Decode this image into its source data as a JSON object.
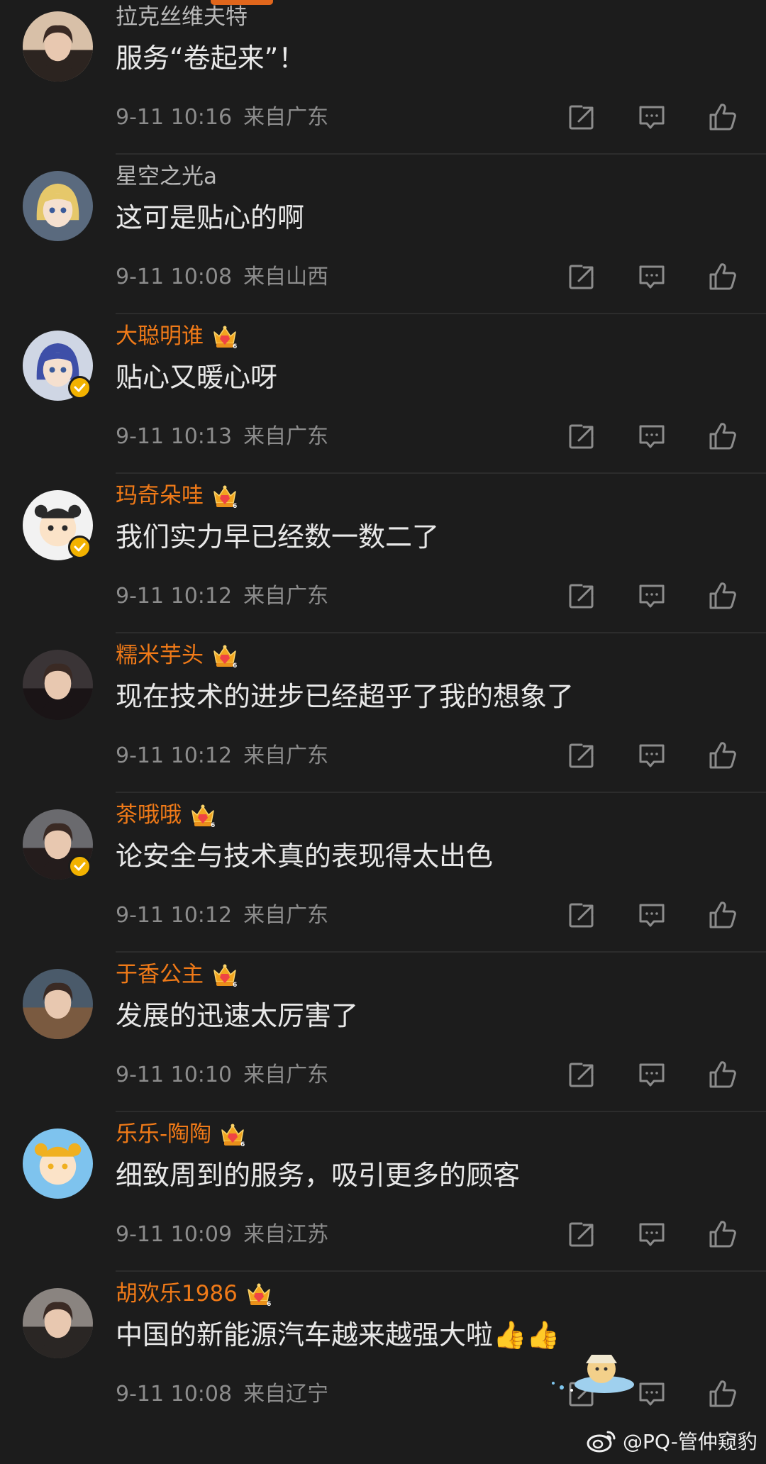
{
  "colors": {
    "background": "#1c1c1c",
    "text": "#e8e8e8",
    "meta": "#8c8c8c",
    "normal_username": "#b8b8b8",
    "vip_username": "#f07a18",
    "accent_tab": "#e0661c",
    "icon": "#8c8c8c",
    "verified_badge": "#f2b200"
  },
  "comments": [
    {
      "username": "拉克丝维夫特",
      "vip": false,
      "verified": false,
      "text": "服务“卷起来”！",
      "date": "9-11 10:16",
      "location": "来自广东",
      "avatar_icon": "photo-avatar",
      "avatar_colors": [
        "#d8c0a8",
        "#2c2420"
      ]
    },
    {
      "username": "星空之光a",
      "vip": false,
      "verified": false,
      "text": "这可是贴心的啊",
      "date": "9-11 10:08",
      "location": "来自山西",
      "avatar_icon": "anime-avatar",
      "avatar_colors": [
        "#5a6a7e",
        "#e6c86a"
      ]
    },
    {
      "username": "大聪明谁",
      "vip": true,
      "verified": true,
      "text": "贴心又暖心呀",
      "date": "9-11 10:13",
      "location": "来自广东",
      "avatar_icon": "anime-avatar",
      "avatar_colors": [
        "#cfd6e4",
        "#3e4fa8"
      ]
    },
    {
      "username": "玛奇朵哇",
      "vip": true,
      "verified": true,
      "text": "我们实力早已经数一数二了",
      "date": "9-11 10:12",
      "location": "来自广东",
      "avatar_icon": "cartoon-avatar",
      "avatar_colors": [
        "#f2f2f2",
        "#2a2a2a"
      ]
    },
    {
      "username": "糯米芋头",
      "vip": true,
      "verified": false,
      "text": "现在技术的进步已经超乎了我的想象了",
      "date": "9-11 10:12",
      "location": "来自广东",
      "avatar_icon": "photo-avatar",
      "avatar_colors": [
        "#3a3436",
        "#1a1416"
      ]
    },
    {
      "username": "茶哦哦",
      "vip": true,
      "verified": true,
      "text": "论安全与技术真的表现得太出色",
      "date": "9-11 10:12",
      "location": "来自广东",
      "avatar_icon": "photo-avatar",
      "avatar_colors": [
        "#6a6a6e",
        "#241c1c"
      ]
    },
    {
      "username": "于香公主",
      "vip": true,
      "verified": false,
      "text": "发展的迅速太厉害了",
      "date": "9-11 10:10",
      "location": "来自广东",
      "avatar_icon": "photo-avatar",
      "avatar_colors": [
        "#4a5a6a",
        "#7a5a40"
      ]
    },
    {
      "username": "乐乐-陶陶",
      "vip": true,
      "verified": false,
      "text": "细致周到的服务，吸引更多的顾客",
      "date": "9-11 10:09",
      "location": "来自江苏",
      "avatar_icon": "cartoon-avatar",
      "avatar_colors": [
        "#7ec3ee",
        "#f0b020"
      ]
    },
    {
      "username": "胡欢乐1986",
      "vip": true,
      "verified": false,
      "text": "中国的新能源汽车越来越强大啦👍👍",
      "date": "9-11 10:08",
      "location": "来自辽宁",
      "avatar_icon": "photo-avatar",
      "avatar_colors": [
        "#8a8480",
        "#2a2624"
      ]
    }
  ],
  "actions": {
    "share_icon": "share-icon",
    "reply_icon": "reply-icon",
    "like_icon": "thumbs-up-icon"
  },
  "watermark": {
    "text": "@PQ-管仲窥豹",
    "icon": "weibo-logo-icon"
  }
}
